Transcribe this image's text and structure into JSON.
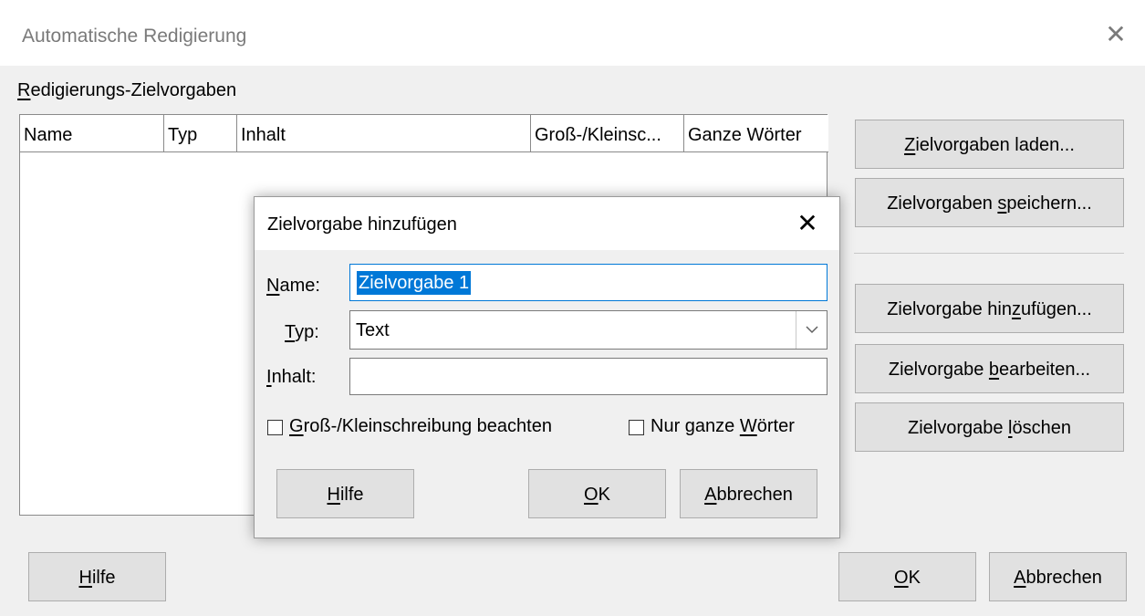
{
  "main": {
    "title": "Automatische Redigierung",
    "close_icon": "close-icon",
    "section_label": "Redigierungs-Zielvorgaben",
    "table": {
      "columns": [
        "Name",
        "Typ",
        "Inhalt",
        "Groß-/Kleinsc...",
        "Ganze Wörter"
      ],
      "rows": []
    },
    "buttons": {
      "load": "Zielvorgaben laden...",
      "save": "Zielvorgaben speichern...",
      "add": "Zielvorgabe hinzufügen...",
      "edit": "Zielvorgabe bearbeiten...",
      "delete": "Zielvorgabe löschen",
      "help": "Hilfe",
      "ok": "OK",
      "cancel": "Abbrechen"
    }
  },
  "dialog": {
    "title": "Zielvorgabe hinzufügen",
    "close_icon": "close-icon",
    "name_label": "Name:",
    "name_value": "Zielvorgabe 1",
    "type_label": "Typ:",
    "type_value": "Text",
    "content_label": "Inhalt:",
    "content_value": "",
    "case_label": "Groß-/Kleinschreibung beachten",
    "case_checked": false,
    "whole_label": "Nur ganze Wörter",
    "whole_checked": false,
    "buttons": {
      "help": "Hilfe",
      "ok": "OK",
      "cancel": "Abbrechen"
    }
  },
  "colors": {
    "accent": "#0078d7",
    "window_bg": "#f0f0f0",
    "button_bg": "#e1e1e1"
  }
}
